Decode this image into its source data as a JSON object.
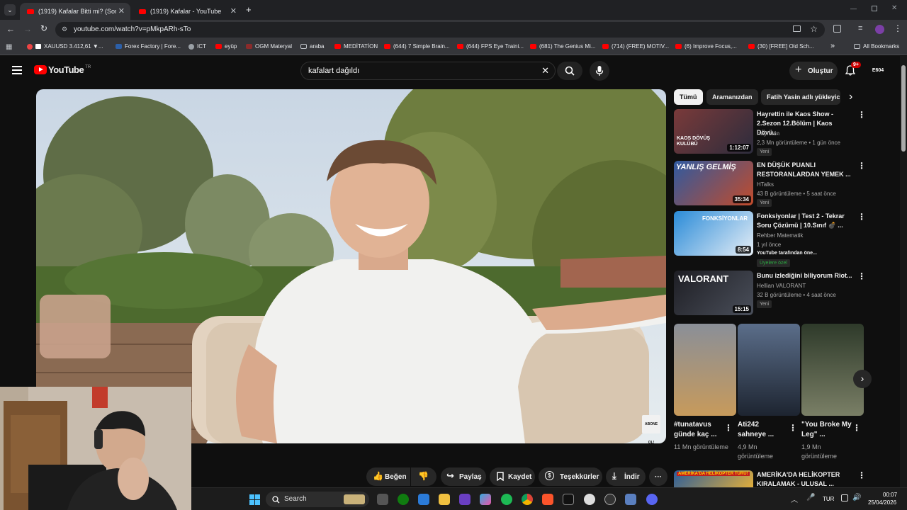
{
  "browser": {
    "tabs": [
      {
        "title": "(1919) Kafalar Bitti mi? (Soru-Ce"
      },
      {
        "title": "(1919) Kafalar - YouTube"
      }
    ],
    "new_tab": "+",
    "url": "youtube.com/watch?v=pMkpARh-sTo",
    "bookmarks": [
      {
        "label": "XAUUSD 3.412,61 ▼..."
      },
      {
        "label": "Forex Factory | Fore..."
      },
      {
        "label": "ICT"
      },
      {
        "label": "eyüp"
      },
      {
        "label": "OGM Materyal"
      },
      {
        "label": "araba"
      },
      {
        "label": "MEDİTATİON"
      },
      {
        "label": "(644) 7 Simple Brain..."
      },
      {
        "label": "(644) FPS Eye Traini..."
      },
      {
        "label": "(681) The Genius Mi..."
      },
      {
        "label": "(714) (FREE) MOTIV..."
      },
      {
        "label": "(6) Improve Focus,..."
      },
      {
        "label": "(30) [FREE] Old Sch..."
      }
    ],
    "bookmarks_more": "»",
    "all_bookmarks": "All Bookmarks"
  },
  "youtube": {
    "logo_text": "YouTube",
    "logo_region": "TR",
    "search_value": "kafalart dağıldı",
    "clear": "✕",
    "create_label": "Oluştur",
    "notif_count": "9+",
    "avatar_label": "E604"
  },
  "video": {
    "watermark": "ABONE OL!"
  },
  "actions": {
    "like": "Beğen",
    "share": "Paylaş",
    "save": "Kaydet",
    "thanks": "Teşekkürler",
    "download": "İndir",
    "more": "···"
  },
  "chips": [
    "Tümü",
    "Aramanızdan",
    "Fatih Yasin adlı yükleyic"
  ],
  "chips_next": "›",
  "related": [
    {
      "title_line1": "Hayrettin ile Kaos Show -",
      "title_line2": "2.Sezon 12.Bölüm | Kaos Dövü...",
      "channel": "Hayrettin",
      "meta": "2,3 Mn görüntüleme • 1 gün önce",
      "badge": "Yeni",
      "duration": "1:12:07",
      "thumb_text": "KAOS DÖVÜŞ KULÜBÜ"
    },
    {
      "title_line1": "EN DÜŞÜK PUANLI",
      "title_line2": "RESTORANLARDAN YEMEK ...",
      "channel": "HTalks",
      "meta": "43 B görüntüleme • 5 saat önce",
      "badge": "Yeni",
      "duration": "35:34",
      "thumb_text": "YANLIŞ GELMİŞ"
    },
    {
      "title_line1": "Fonksiyonlar | Test 2 - Tekrar",
      "title_line2": "Soru Çözümü | 10.Sınıf 💣 ...",
      "channel": "Rehber Matematik",
      "meta": "1 yıl önce",
      "extra": "YouTube tarafından öne...",
      "badge": "Üyelere özel",
      "duration": "8:54",
      "thumb_text": "FONKSİYONLAR"
    },
    {
      "title_line1": "Bunu izlediğini biliyorum Riot...",
      "title_line2": "",
      "channel": "Hellian VALORANT",
      "meta": "32 B görüntüleme • 4 saat önce",
      "badge": "Yeni",
      "duration": "15:15",
      "thumb_text": "VALORANT"
    }
  ],
  "shorts": [
    {
      "title": "#tunatavus günde kaç ...",
      "views": "11 Mn görüntüleme"
    },
    {
      "title": "Ati242 sahneye ...",
      "views": "4,9 Mn görüntüleme"
    },
    {
      "title": "\"You Broke My Leg\" ...",
      "views": "1,9 Mn görüntüleme"
    }
  ],
  "last_related": {
    "title_line1": "AMERİKA'DA HELİKOPTER",
    "title_line2": "KIRALAMAK - ULUSAL ...",
    "thumb_text": "AMERİKA'DA HELİKOPTER TURU!"
  },
  "taskbar": {
    "search_placeholder": "Search",
    "lang": "TUR",
    "time": "00:07",
    "date": "25/04/2026"
  }
}
